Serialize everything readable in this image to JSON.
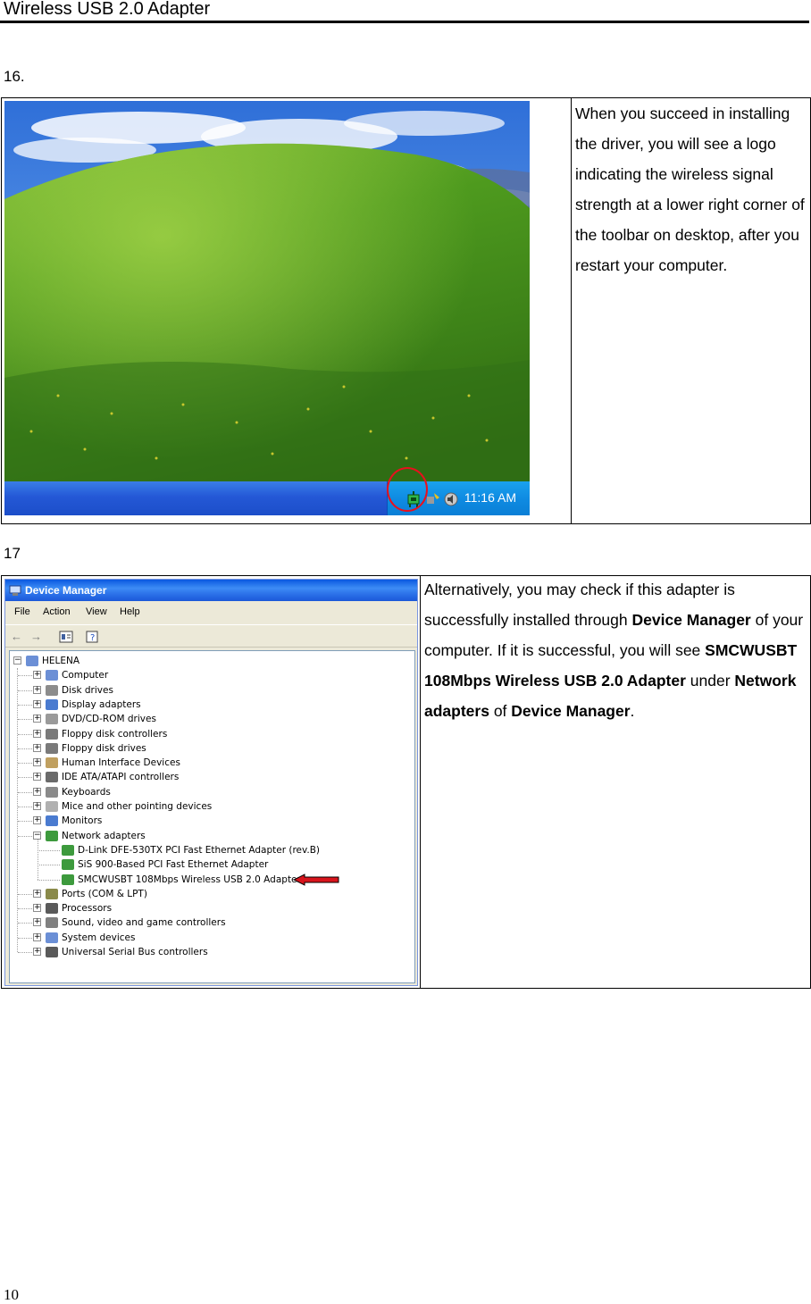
{
  "header": {
    "title": "Wireless USB 2.0 Adapter"
  },
  "step16": {
    "number": "16.",
    "description": "When you succeed in installing the driver, you will see a logo indicating the wireless signal strength at a lower right corner of the toolbar on desktop, after you restart your computer.",
    "taskbar_clock": "11:16 AM",
    "icons": [
      "wireless-signal-icon",
      "network-icon",
      "speaker-icon"
    ]
  },
  "step17": {
    "number": "17",
    "description_parts": [
      {
        "text": "Alternatively, you may check if this adapter is successfully installed through ",
        "bold": false
      },
      {
        "text": "Device Manager",
        "bold": true
      },
      {
        "text": " of your computer. If it is successful, you will see ",
        "bold": false
      },
      {
        "text": "SMCWUSBT 108Mbps Wireless USB 2.0 Adapter",
        "bold": true
      },
      {
        "text": " under ",
        "bold": false
      },
      {
        "text": "Network adapters",
        "bold": true
      },
      {
        "text": " of ",
        "bold": false
      },
      {
        "text": "Device Manager",
        "bold": true
      },
      {
        "text": ".",
        "bold": false
      }
    ],
    "device_manager": {
      "title": "Device Manager",
      "menu": [
        "File",
        "Action",
        "View",
        "Help"
      ],
      "root": "HELENA",
      "categories": [
        {
          "label": "Computer",
          "icon": "computer-icon",
          "color": "#6b8fd6"
        },
        {
          "label": "Disk drives",
          "icon": "disk-drive-icon",
          "color": "#8c8c8c"
        },
        {
          "label": "Display adapters",
          "icon": "display-adapter-icon",
          "color": "#4a7bd0"
        },
        {
          "label": "DVD/CD-ROM drives",
          "icon": "cdrom-icon",
          "color": "#9a9a9a"
        },
        {
          "label": "Floppy disk controllers",
          "icon": "floppy-controller-icon",
          "color": "#7a7a7a"
        },
        {
          "label": "Floppy disk drives",
          "icon": "floppy-drive-icon",
          "color": "#7a7a7a"
        },
        {
          "label": "Human Interface Devices",
          "icon": "hid-icon",
          "color": "#c0a060"
        },
        {
          "label": "IDE ATA/ATAPI controllers",
          "icon": "ide-icon",
          "color": "#6a6a6a"
        },
        {
          "label": "Keyboards",
          "icon": "keyboard-icon",
          "color": "#8a8a8a"
        },
        {
          "label": "Mice and other pointing devices",
          "icon": "mouse-icon",
          "color": "#b0b0b0"
        },
        {
          "label": "Monitors",
          "icon": "monitor-icon",
          "color": "#4a7bd0"
        },
        {
          "label": "Network adapters",
          "icon": "network-adapter-icon",
          "color": "#3d9a3d",
          "expanded": true,
          "children": [
            "D-Link DFE-530TX PCI Fast Ethernet Adapter (rev.B)",
            "SiS 900-Based PCI Fast Ethernet Adapter",
            "SMCWUSBT 108Mbps Wireless USB 2.0 Adapter"
          ]
        },
        {
          "label": "Ports (COM & LPT)",
          "icon": "port-icon",
          "color": "#8a8a4a"
        },
        {
          "label": "Processors",
          "icon": "processor-icon",
          "color": "#5a5a5a"
        },
        {
          "label": "Sound, video and game controllers",
          "icon": "sound-icon",
          "color": "#808080"
        },
        {
          "label": "System devices",
          "icon": "system-device-icon",
          "color": "#6b8fd6"
        },
        {
          "label": "Universal Serial Bus controllers",
          "icon": "usb-icon",
          "color": "#5a5a5a"
        }
      ]
    }
  },
  "footer": {
    "page_number": "10"
  },
  "colors": {
    "highlight_circle": "#e8101e",
    "arrow": "#d8141c",
    "taskbar": "#245edb"
  }
}
